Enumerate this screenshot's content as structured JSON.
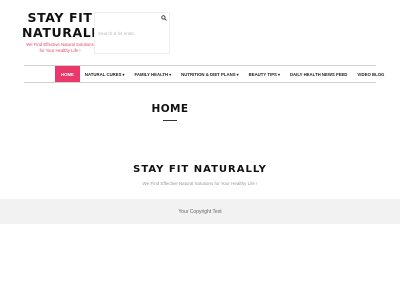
{
  "brand": {
    "title_line1": "STAY FIT",
    "title_line2": "NATURALLY",
    "tagline_line1": "We Find Effective Natural Solutions",
    "tagline_line2": "for Your Healthy Life !"
  },
  "search": {
    "placeholder": "Search & hit enter..",
    "icon": "search-icon"
  },
  "nav": {
    "items": [
      {
        "label": "HOME",
        "active": true,
        "has_dropdown": false
      },
      {
        "label": "NATURAL CURES",
        "active": false,
        "has_dropdown": true
      },
      {
        "label": "FAMILY HEALTH",
        "active": false,
        "has_dropdown": true
      },
      {
        "label": "NUTRITION & DIET PLANS",
        "active": false,
        "has_dropdown": true
      },
      {
        "label": "BEAUTY TIPS",
        "active": false,
        "has_dropdown": true
      },
      {
        "label": "DAILY HEALTH NEWS FEED",
        "active": false,
        "has_dropdown": false
      },
      {
        "label": "VIDEO BLOG",
        "active": false,
        "has_dropdown": false
      }
    ],
    "dropdown_glyph": "▾"
  },
  "page": {
    "heading": "HOME"
  },
  "site_banner": {
    "title": "STAY FIT NATURALLY",
    "subtitle": "We Find Effective Natural Solutions for Your Healthy Life !"
  },
  "footer": {
    "copyright": "Your Copyright Text"
  },
  "colors": {
    "accent": "#e8396a",
    "tagline": "#e0466c",
    "footer_bg": "#f2f2f2"
  }
}
